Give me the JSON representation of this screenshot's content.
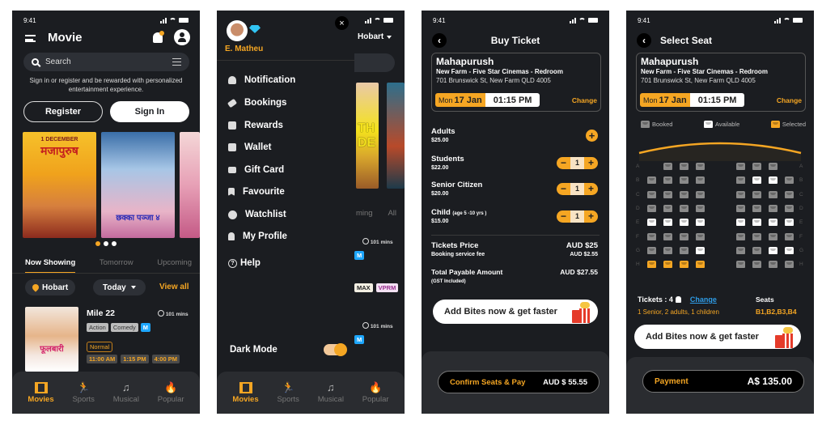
{
  "status_time": "9:41",
  "colors": {
    "accent": "#f5a623",
    "bg": "#1b1d21",
    "panel": "#2a2c30",
    "tag_blue": "#1ea7fd"
  },
  "bottom_nav": [
    {
      "label": "Movies",
      "icon": "film-icon",
      "active": true
    },
    {
      "label": "Sports",
      "icon": "running-icon",
      "active": false
    },
    {
      "label": "Musical",
      "icon": "ticket-music-icon",
      "active": false
    },
    {
      "label": "Popular",
      "icon": "fire-icon",
      "active": false
    }
  ],
  "home": {
    "title": "Movie",
    "search_placeholder": "Search",
    "info_text": "Sign in or register and be rewarded with personalized entertainment experience.",
    "register_label": "Register",
    "signin_label": "Sign In",
    "posters": [
      "Mahapurush",
      "Dhakka Pakka 2",
      "Phoolvari"
    ],
    "carousel_pages": 3,
    "carousel_active": 1,
    "tabs": [
      "Now Showing",
      "Tomorrow",
      "Upcoming"
    ],
    "location": "Hobart",
    "date_filter": "Today",
    "view_all": "View all",
    "movie": {
      "title": "Mile 22",
      "duration": "101 mins",
      "genres": [
        "Action",
        "Comedy"
      ],
      "rating": "M",
      "format": "Normal",
      "times": [
        "11:00 AM",
        "1:15 PM",
        "4:00 PM"
      ]
    }
  },
  "drawer": {
    "user_name": "E. Matheu",
    "close_label": "×",
    "items": [
      {
        "label": "Notification",
        "icon": "bell-icon"
      },
      {
        "label": "Bookings",
        "icon": "ticket-icon"
      },
      {
        "label": "Rewards",
        "icon": "gift-icon"
      },
      {
        "label": "Wallet",
        "icon": "wallet-icon"
      },
      {
        "label": "Gift Card",
        "icon": "gift-card-icon"
      },
      {
        "label": "Favourite",
        "icon": "bookmark-icon"
      },
      {
        "label": "Watchlist",
        "icon": "clock-icon"
      },
      {
        "label": "My Profile",
        "icon": "user-icon"
      },
      {
        "label": "Help",
        "icon": "help-icon"
      }
    ],
    "dark_mode_label": "Dark Mode",
    "dark_mode_on": true,
    "bg_location": "Hobart",
    "bg_tabs": [
      "ming",
      "All"
    ],
    "bg_duration": "101 mins",
    "bg_rating": "M",
    "bg_tags": [
      "MAX",
      "VPRM"
    ]
  },
  "buy": {
    "title": "Buy Ticket",
    "movie": "Mahapurush",
    "venue": "New Farm - Five Star Cinemas - Redroom",
    "address": "701 Brunswick St, New Farm QLD 4005",
    "day": "Mon",
    "date": "17 Jan",
    "time": "01:15 PM",
    "change": "Change",
    "tickets": [
      {
        "name": "Adults",
        "note": "",
        "price": "$25.00",
        "qty": 0
      },
      {
        "name": "Students",
        "note": "",
        "price": "$22.00",
        "qty": 1
      },
      {
        "name": "Senior Citizen",
        "note": "",
        "price": "$20.00",
        "qty": 1
      },
      {
        "name": "Child",
        "note": "(age 5 -10 yrs )",
        "price": "$15.00",
        "qty": 1
      }
    ],
    "tickets_price_label": "Tickets Price",
    "tickets_price": "AUD  $25",
    "fee_label": "Booking service fee",
    "fee": "AUD  $2.55",
    "total_label": "Total Payable Amount",
    "total": "AUD $27.55",
    "gst": "(GST Included)",
    "bites": "Add Bites now & get faster",
    "confirm": "Confirm Seats & Pay",
    "confirm_amount": "AUD $ 55.55"
  },
  "seat": {
    "title": "Select Seat",
    "legend": [
      "Booked",
      "Available",
      "Selected"
    ],
    "rows": [
      "A",
      "B",
      "C",
      "D",
      "E",
      "F",
      "G",
      "H"
    ],
    "layout": [
      "-bbb bbb-",
      "bbbb baab",
      "bbbb bbbb",
      "bbbb bbbb",
      "aaaa aaaa",
      "bbbb bbbb",
      "bbba bbaa",
      "ssss bbbb"
    ],
    "tickets_label": "Tickets : 4",
    "change": "Change",
    "ticket_breakdown": "1 Senior, 2 adults, 1 children",
    "seats_label": "Seats",
    "seats": "B1,B2,B3,B4",
    "bites": "Add Bites now & get faster",
    "pay_label": "Payment",
    "pay_amount": "A$ 135.00"
  }
}
